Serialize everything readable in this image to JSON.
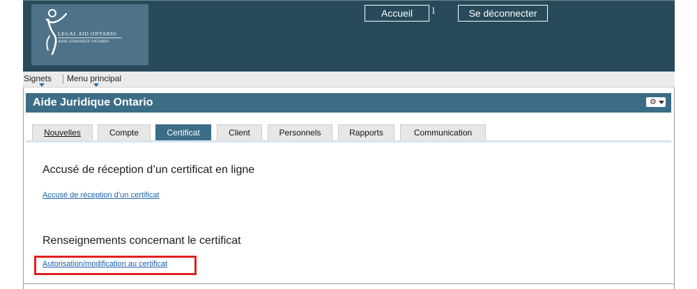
{
  "header": {
    "logo": {
      "name_en": "LEGAL AID ONTARIO",
      "name_fr": "AIDE JURIDIQUE ONTARIO",
      "icon": "legal-aid-figure-logo"
    },
    "home_label": "Accueil",
    "separator": "l",
    "logout_label": "Se déconnecter"
  },
  "bookmarks_bar": {
    "items": [
      {
        "label": "Signets"
      },
      {
        "label": "Menu principal"
      }
    ]
  },
  "page": {
    "title": "Aide Juridique Ontario",
    "settings_icon": "gear-icon"
  },
  "tabs": [
    {
      "label": "Nouvelles",
      "active": false
    },
    {
      "label": "Compte",
      "active": false
    },
    {
      "label": "Certificat",
      "active": true
    },
    {
      "label": "Client",
      "active": false
    },
    {
      "label": "Personnels",
      "active": false
    },
    {
      "label": "Rapports",
      "active": false
    },
    {
      "label": "Communication",
      "active": false
    }
  ],
  "content": {
    "sections": [
      {
        "title": "Accusé de réception d’un certificat en ligne",
        "links": [
          "Accusé de réception d’un certificat"
        ]
      },
      {
        "title": "Renseignements concernant le certificat",
        "links": [
          "Autorisation/modification au certificat"
        ]
      }
    ]
  },
  "colors": {
    "header_bg": "#284a5a",
    "logo_bg": "#4e7388",
    "title_bar": "#3b6d86",
    "link": "#1d5fa8",
    "highlight": "#e0201d"
  }
}
